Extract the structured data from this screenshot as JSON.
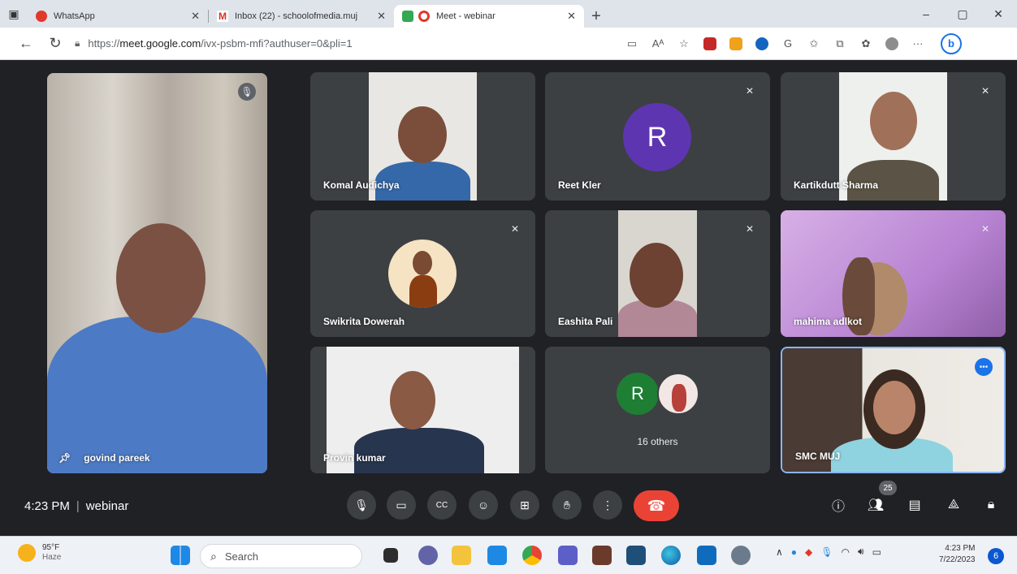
{
  "browser": {
    "tabs": [
      {
        "title": "WhatsApp",
        "favicon_color": "#e0392b"
      },
      {
        "title": "Inbox (22) - schoolofmedia.muj",
        "favicon_color": "#d93025"
      },
      {
        "title": "Meet - webinar",
        "favicon_color": "#e0392b"
      }
    ],
    "new_tab": "+",
    "window_controls": [
      "–",
      "▢",
      "✕"
    ],
    "url_prefix": "https://",
    "url_host": "meet.google.com",
    "url_path": "/ivx-psbm-mfi?authuser=0&pli=1"
  },
  "meet": {
    "participants": [
      {
        "name": "govind pareek",
        "pinned": true
      },
      {
        "name": "Komal Audichya",
        "muted": false
      },
      {
        "name": "Reet Kler",
        "avatar_letter": "R",
        "avatar_color": "#5e35b1",
        "muted": true
      },
      {
        "name": "Kartikdutt Sharma",
        "muted": true
      },
      {
        "name": "Swikrita Dowerah",
        "muted": true
      },
      {
        "name": "Eashita Pali",
        "muted": true
      },
      {
        "name": "mahima adlkot",
        "muted": true
      },
      {
        "name": "Provin kumar",
        "muted": true
      },
      {
        "name": "SMC MUJ",
        "self": true
      }
    ],
    "others": {
      "avatar_letter": "R",
      "avatar_color": "#1e7e34",
      "label": "16 others"
    },
    "meeting_time": "4:23 PM",
    "meeting_name": "webinar",
    "participant_count": "25"
  },
  "taskbar": {
    "weather_temp": "95°F",
    "weather_cond": "Haze",
    "search_placeholder": "Search",
    "time": "4:23 PM",
    "date": "7/22/2023",
    "notif_count": "6"
  }
}
